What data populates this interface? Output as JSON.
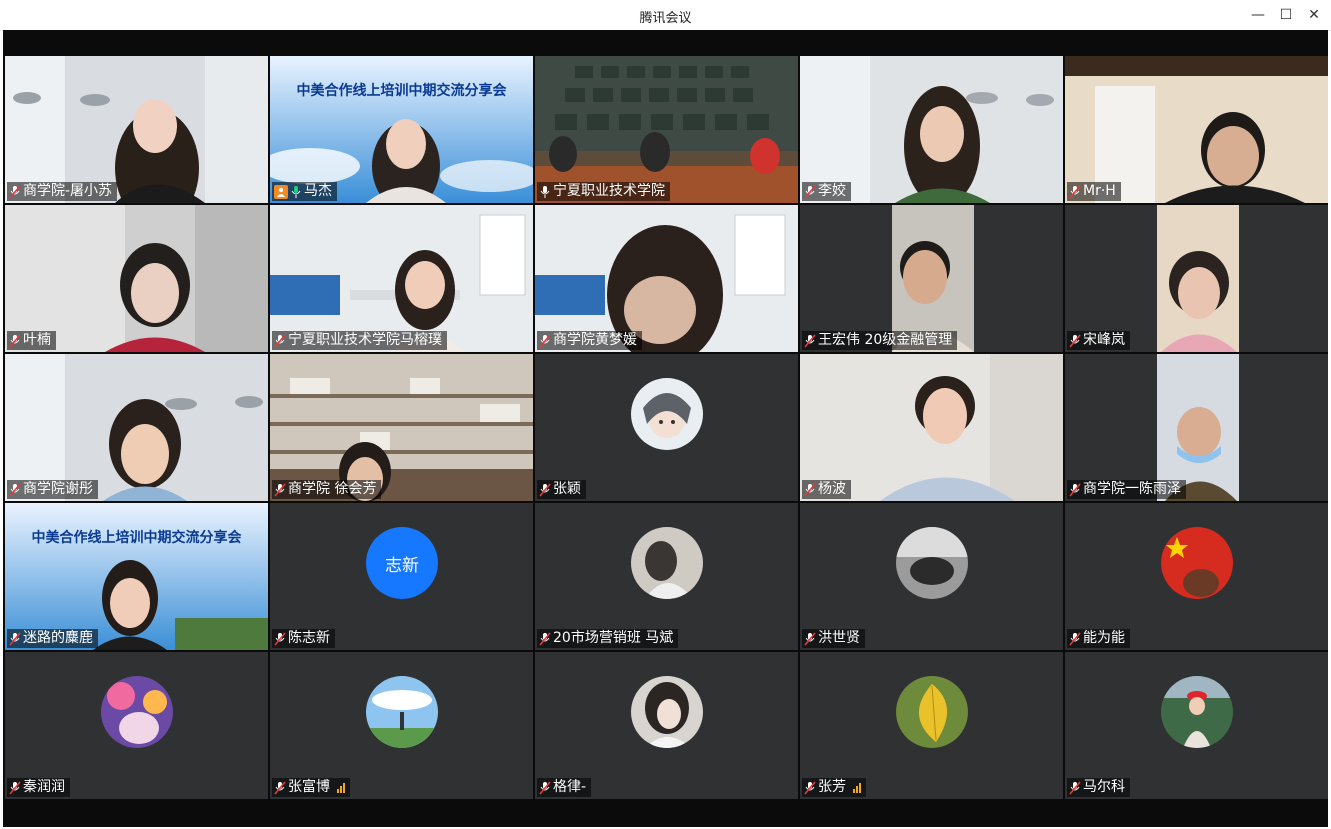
{
  "window": {
    "title": "腾讯会议",
    "controls": {
      "minimize": "—",
      "maximize": "☐",
      "close": "✕"
    }
  },
  "banner": {
    "title": "中美合作线上培训中期交流分享会"
  },
  "participants": [
    {
      "name": "商学院-屠小苏",
      "type": "video"
    },
    {
      "name": "马杰",
      "type": "video",
      "host": true,
      "speaking": true
    },
    {
      "name": "宁夏职业技术学院",
      "type": "video",
      "speaking": true
    },
    {
      "name": "李姣",
      "type": "video"
    },
    {
      "name": "Mr·H",
      "type": "video"
    },
    {
      "name": "叶楠",
      "type": "video"
    },
    {
      "name": "宁夏职业技术学院马榕璞",
      "type": "video"
    },
    {
      "name": "商学院黄梦媛",
      "type": "video"
    },
    {
      "name": "王宏伟 20级金融管理",
      "type": "video"
    },
    {
      "name": "宋峰岚",
      "type": "video"
    },
    {
      "name": "商学院谢彤",
      "type": "video"
    },
    {
      "name": "商学院 徐会芳",
      "type": "video"
    },
    {
      "name": "张颖",
      "type": "avatar"
    },
    {
      "name": "杨波",
      "type": "video"
    },
    {
      "name": "商学院一陈雨泽",
      "type": "video"
    },
    {
      "name": "迷路的麋鹿",
      "type": "video"
    },
    {
      "name": "陈志新",
      "type": "avatar",
      "avatar_text": "志新"
    },
    {
      "name": "20市场营销班  马斌",
      "type": "avatar"
    },
    {
      "name": "洪世贤",
      "type": "avatar"
    },
    {
      "name": "能为能",
      "type": "avatar"
    },
    {
      "name": "秦润润",
      "type": "avatar"
    },
    {
      "name": "张富博",
      "type": "avatar",
      "signal": true
    },
    {
      "name": "格律-",
      "type": "avatar"
    },
    {
      "name": "张芳",
      "type": "avatar",
      "signal": true
    },
    {
      "name": "马尔科",
      "type": "avatar"
    }
  ],
  "colors": {
    "stage": "#0b0b0c",
    "tile": "#303133",
    "speaking_border": "#19b26b",
    "avatar_blue": "#1677ff",
    "signal": "#f5a623",
    "host_badge": "#f08a24"
  }
}
